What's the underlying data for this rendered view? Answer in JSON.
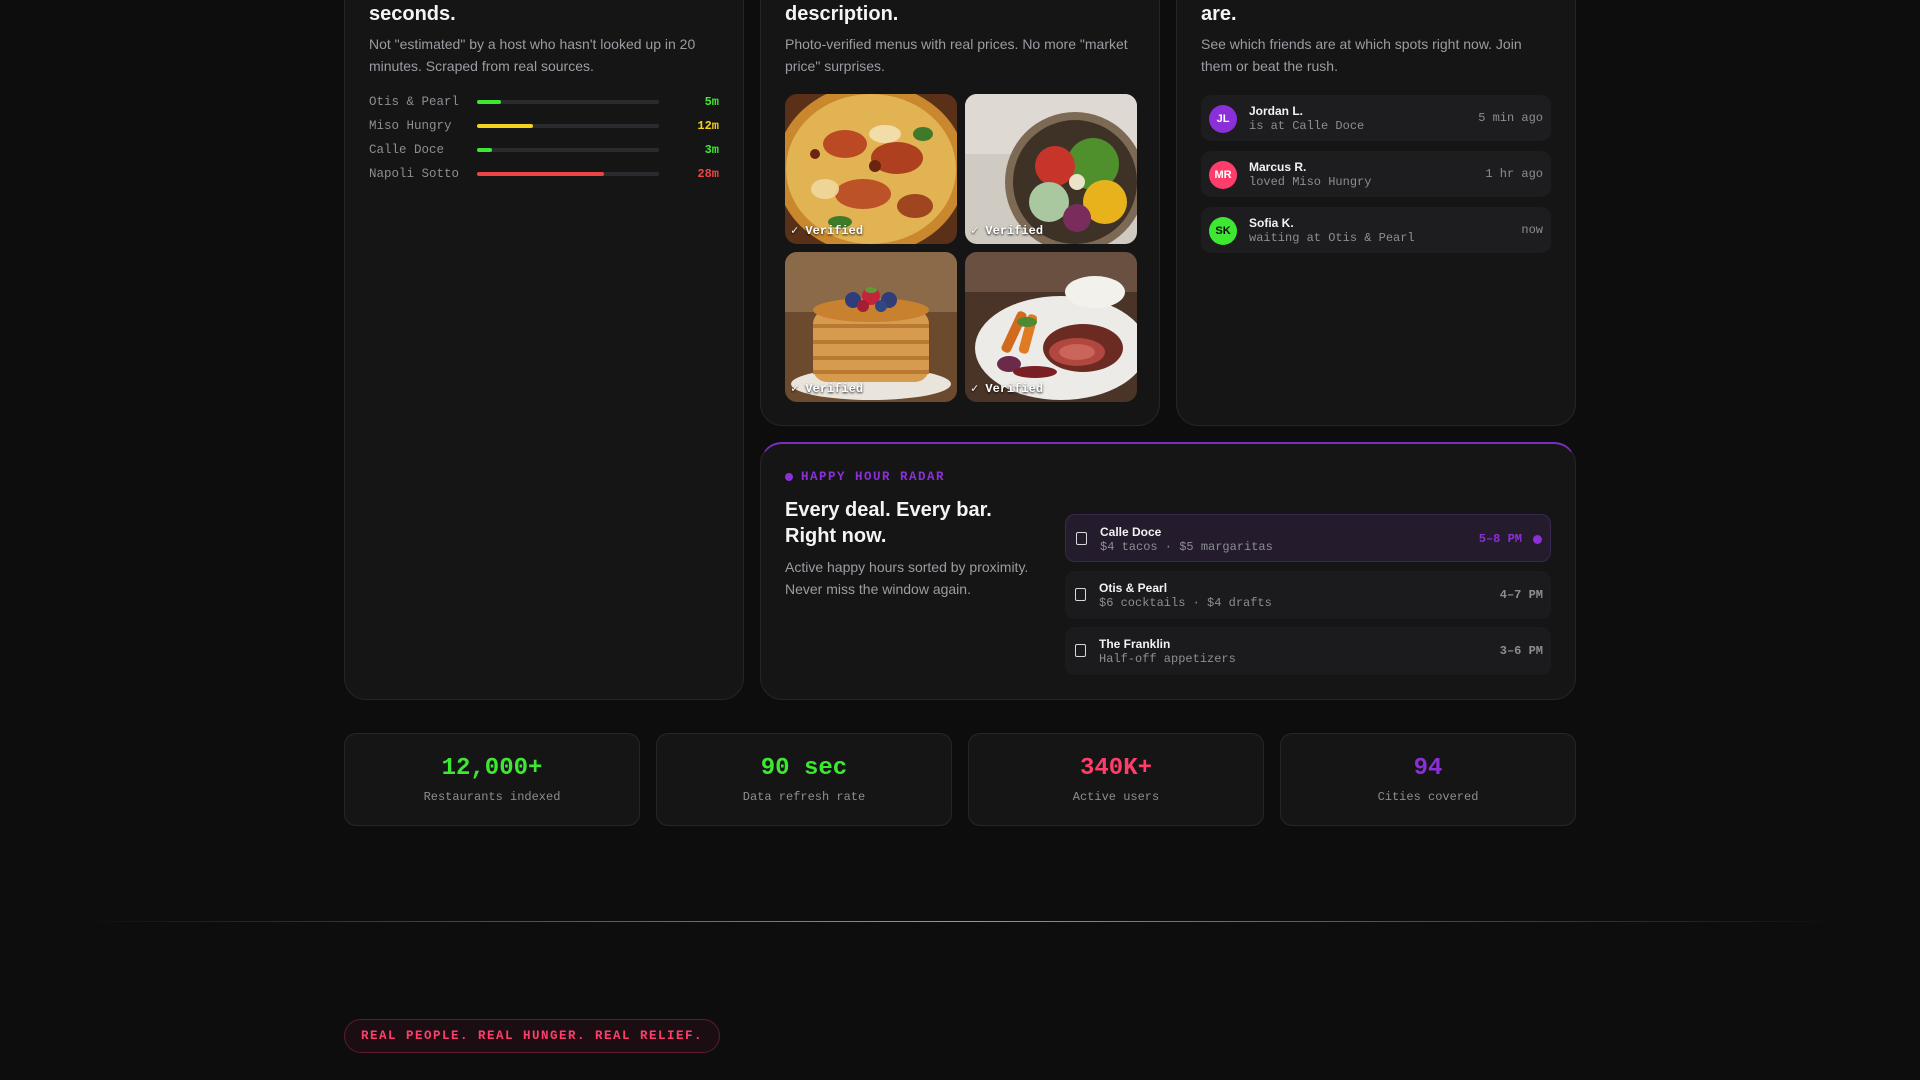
{
  "colors": {
    "green": "#3ee832",
    "yellow": "#f5d11e",
    "red": "#ef4444",
    "purple": "#8b2fd8",
    "pink": "#ff3d6b"
  },
  "wait_card": {
    "title": "seconds.",
    "description": "Not \"estimated\" by a host who hasn't looked up in 20 minutes. Scraped from real sources.",
    "rows": [
      {
        "name": "Otis & Pearl",
        "wait": "5m",
        "level": 0.13,
        "color": "#3ee832"
      },
      {
        "name": "Miso Hungry",
        "wait": "12m",
        "level": 0.31,
        "color": "#f5d11e"
      },
      {
        "name": "Calle Doce",
        "wait": "3m",
        "level": 0.08,
        "color": "#3ee832"
      },
      {
        "name": "Napoli Sotto",
        "wait": "28m",
        "level": 0.7,
        "color": "#ef4444"
      }
    ]
  },
  "menu_card": {
    "title": "description.",
    "description": "Photo-verified menus with real prices. No more \"market price\" surprises.",
    "photos": [
      {
        "name": "pizza-photo",
        "badge": "✓ Verified"
      },
      {
        "name": "salad-bowl-photo",
        "badge": "✓ Verified"
      },
      {
        "name": "pancakes-photo",
        "badge": "✓ Verified"
      },
      {
        "name": "steak-photo",
        "badge": "✓ Verified"
      }
    ]
  },
  "friends_card": {
    "title": "are.",
    "description": "See which friends are at which spots right now. Join them or beat the rush.",
    "friends": [
      {
        "initials": "JL",
        "name": "Jordan L.",
        "status": "is at Calle Doce",
        "time": "5 min ago",
        "color": "#8b2fd8"
      },
      {
        "initials": "MR",
        "name": "Marcus R.",
        "status": "loved Miso Hungry",
        "time": "1 hr ago",
        "color": "#ff3d6b"
      },
      {
        "initials": "SK",
        "name": "Sofia K.",
        "status": "waiting at Otis & Pearl",
        "time": "now",
        "color": "#3ee832"
      }
    ]
  },
  "happy_hour": {
    "eyebrow": "HAPPY HOUR RADAR",
    "title_line1": "Every deal. Every bar.",
    "title_line2": "Right now.",
    "description": "Active happy hours sorted by proximity. Never miss the window again.",
    "items": [
      {
        "name": "Calle Doce",
        "deal": "$4 tacos · $5 margaritas",
        "time": "5–8 PM",
        "active": true
      },
      {
        "name": "Otis & Pearl",
        "deal": "$6 cocktails · $4 drafts",
        "time": "4–7 PM",
        "active": false
      },
      {
        "name": "The Franklin",
        "deal": "Half-off appetizers",
        "time": "3–6 PM",
        "active": false
      }
    ]
  },
  "stats": [
    {
      "value": "12,000+",
      "label": "Restaurants indexed",
      "color": "#3ee832"
    },
    {
      "value": "90 sec",
      "label": "Data refresh rate",
      "color": "#3ee832"
    },
    {
      "value": "340K+",
      "label": "Active users",
      "color": "#ff3d6b"
    },
    {
      "value": "94",
      "label": "Cities covered",
      "color": "#8b2fd8"
    }
  ],
  "tagline": "REAL PEOPLE. REAL HUNGER. REAL RELIEF."
}
